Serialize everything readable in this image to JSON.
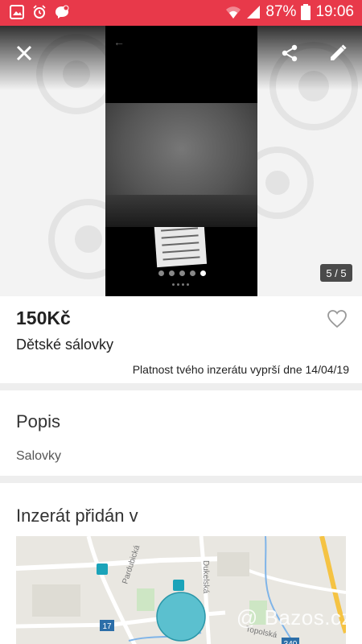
{
  "status_bar": {
    "battery": "87%",
    "time": "19:06",
    "icons": [
      "image-icon",
      "alarm-icon",
      "messenger-icon",
      "wifi-icon",
      "signal-icon",
      "battery-icon"
    ]
  },
  "gallery": {
    "counter": "5 / 5",
    "page_count": 5,
    "active_page": 5,
    "actions": [
      "close-icon",
      "share-icon",
      "edit-icon"
    ]
  },
  "listing": {
    "price": "150Kč",
    "title": "Dětské sálovky",
    "expiry": "Platnost tvého inzerátu vyprší dne 14/04/19"
  },
  "description": {
    "heading": "Popis",
    "text": "Salovky"
  },
  "location": {
    "heading": "Inzerát přidán v",
    "map_labels": {
      "street1": "Pardubická",
      "street2": "Dukelská",
      "street3": "Topolská",
      "route1": "17",
      "route2": "340"
    },
    "watermark": "@ Bazos.cz"
  },
  "colors": {
    "status_bar": "#e8394a",
    "map_circle": "#5bc0cf"
  }
}
